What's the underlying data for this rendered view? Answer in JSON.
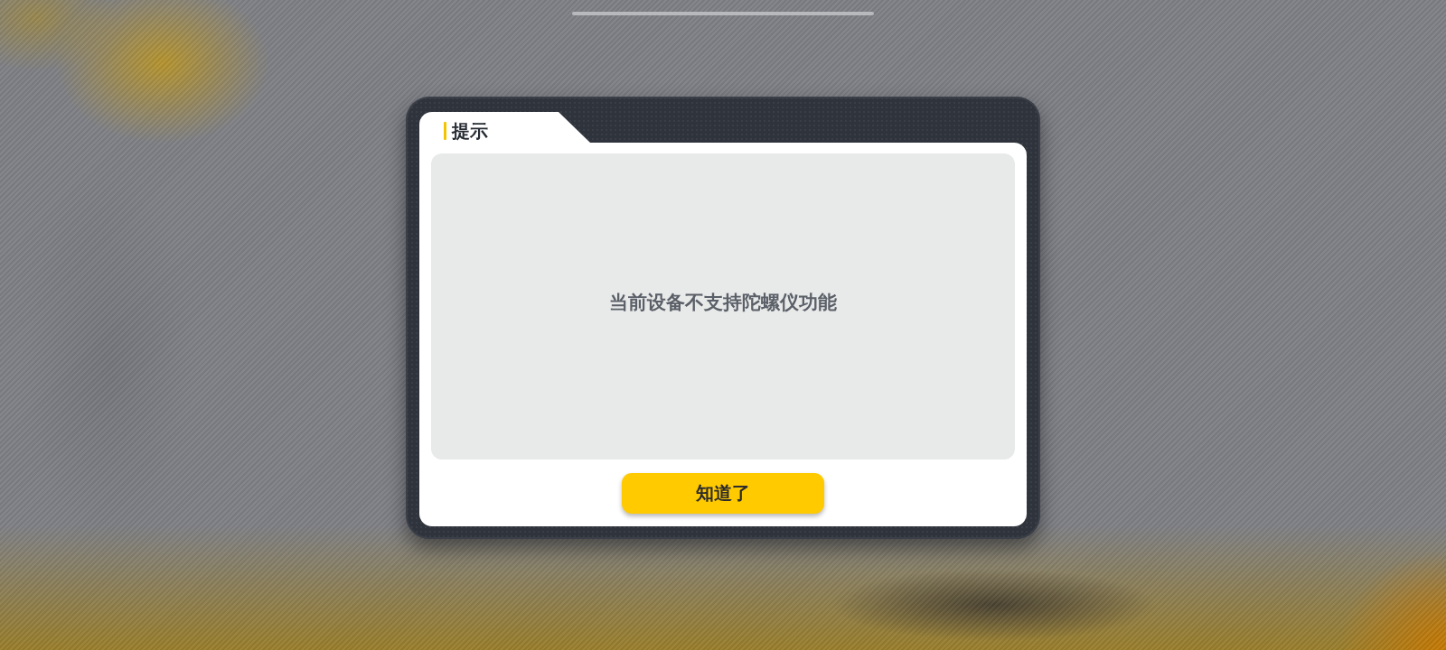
{
  "dialog": {
    "title": "提示",
    "message": "当前设备不支持陀螺仪功能",
    "button": {
      "label": "知道了"
    }
  }
}
